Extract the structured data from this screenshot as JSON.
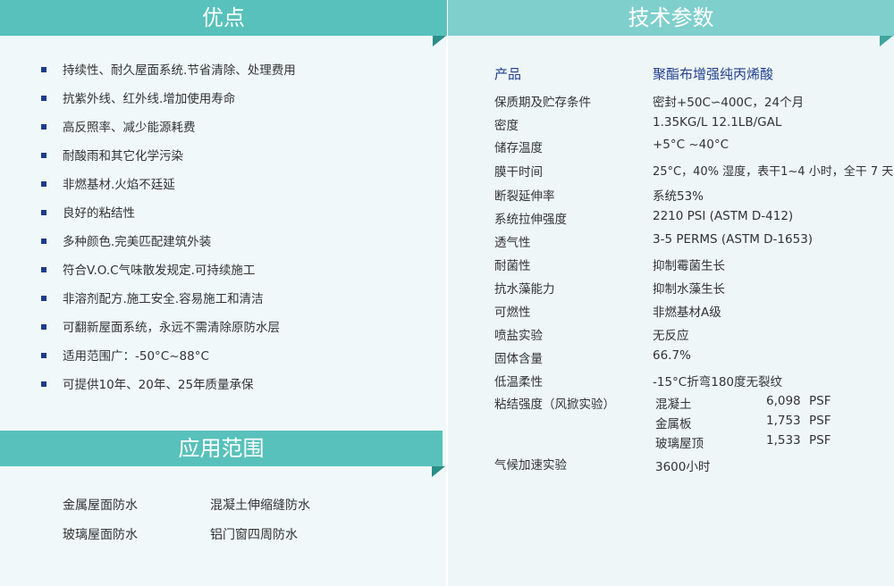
{
  "advantages": {
    "title": "优点",
    "items": [
      "持续性、耐久屋面系统.节省清除、处理费用",
      "抗紫外线、红外线.增加使用寿命",
      "高反照率、减少能源耗费",
      "耐酸雨和其它化学污染",
      "非燃基材.火焰不廷延",
      "良好的粘结性",
      "多种颜色.完美匹配建筑外装",
      "符合V.O.C气味散发规定.可持续施工",
      "非溶剂配方.施工安全.容易施工和清洁",
      "可翻新屋面系统，永远不需清除原防水层",
      "适用范围广：-50°C~88°C",
      "可提供10年、20年、25年质量承保"
    ]
  },
  "application": {
    "title": "应用范围",
    "items": [
      "金属屋面防水",
      "混凝土伸缩缝防水",
      "玻璃屋面防水",
      "铝门窗四周防水"
    ]
  },
  "specs": {
    "title": "技术参数",
    "header": {
      "label": "产品",
      "value": "聚酯布增强纯丙烯酸"
    },
    "rows": [
      {
        "label": "保质期及贮存条件",
        "value": "密封+50C∽400C，24个月"
      },
      {
        "label": "密度",
        "value": "1.35KG/L 12.1LB/GAL"
      },
      {
        "label": "储存温度",
        "value": "+5°C ~40°C"
      },
      {
        "label": "膜干时间",
        "value": "25°C，40% 湿度，表干1~4 小时，全干 7 天"
      },
      {
        "label": "断裂延伸率",
        "value": "系统53%"
      },
      {
        "label": "系统拉伸强度",
        "value": "2210 PSI (ASTM D-412)"
      },
      {
        "label": "透气性",
        "value": "3-5 PERMS (ASTM D-1653)"
      },
      {
        "label": "耐菌性",
        "value": "抑制霉菌生长"
      },
      {
        "label": "抗水藻能力",
        "value": "抑制水藻生长"
      },
      {
        "label": "可燃性",
        "value": "非燃基材A级"
      },
      {
        "label": "喷盐实验",
        "value": "无反应"
      },
      {
        "label": "固体含量",
        "value": "66.7%"
      },
      {
        "label": "低温柔性",
        "value": "-15°C折弯180度无裂纹"
      }
    ],
    "adhesion": {
      "label": "粘结强度（风掀实验）",
      "rows": [
        {
          "name": "混凝土",
          "value": "6,098",
          "unit": "PSF"
        },
        {
          "name": "金属板",
          "value": "1,753",
          "unit": "PSF"
        },
        {
          "name": "玻璃屋顶",
          "value": "1,533",
          "unit": "PSF"
        }
      ]
    },
    "weathering": {
      "label": "气候加速实验",
      "value": "3600小时"
    }
  }
}
